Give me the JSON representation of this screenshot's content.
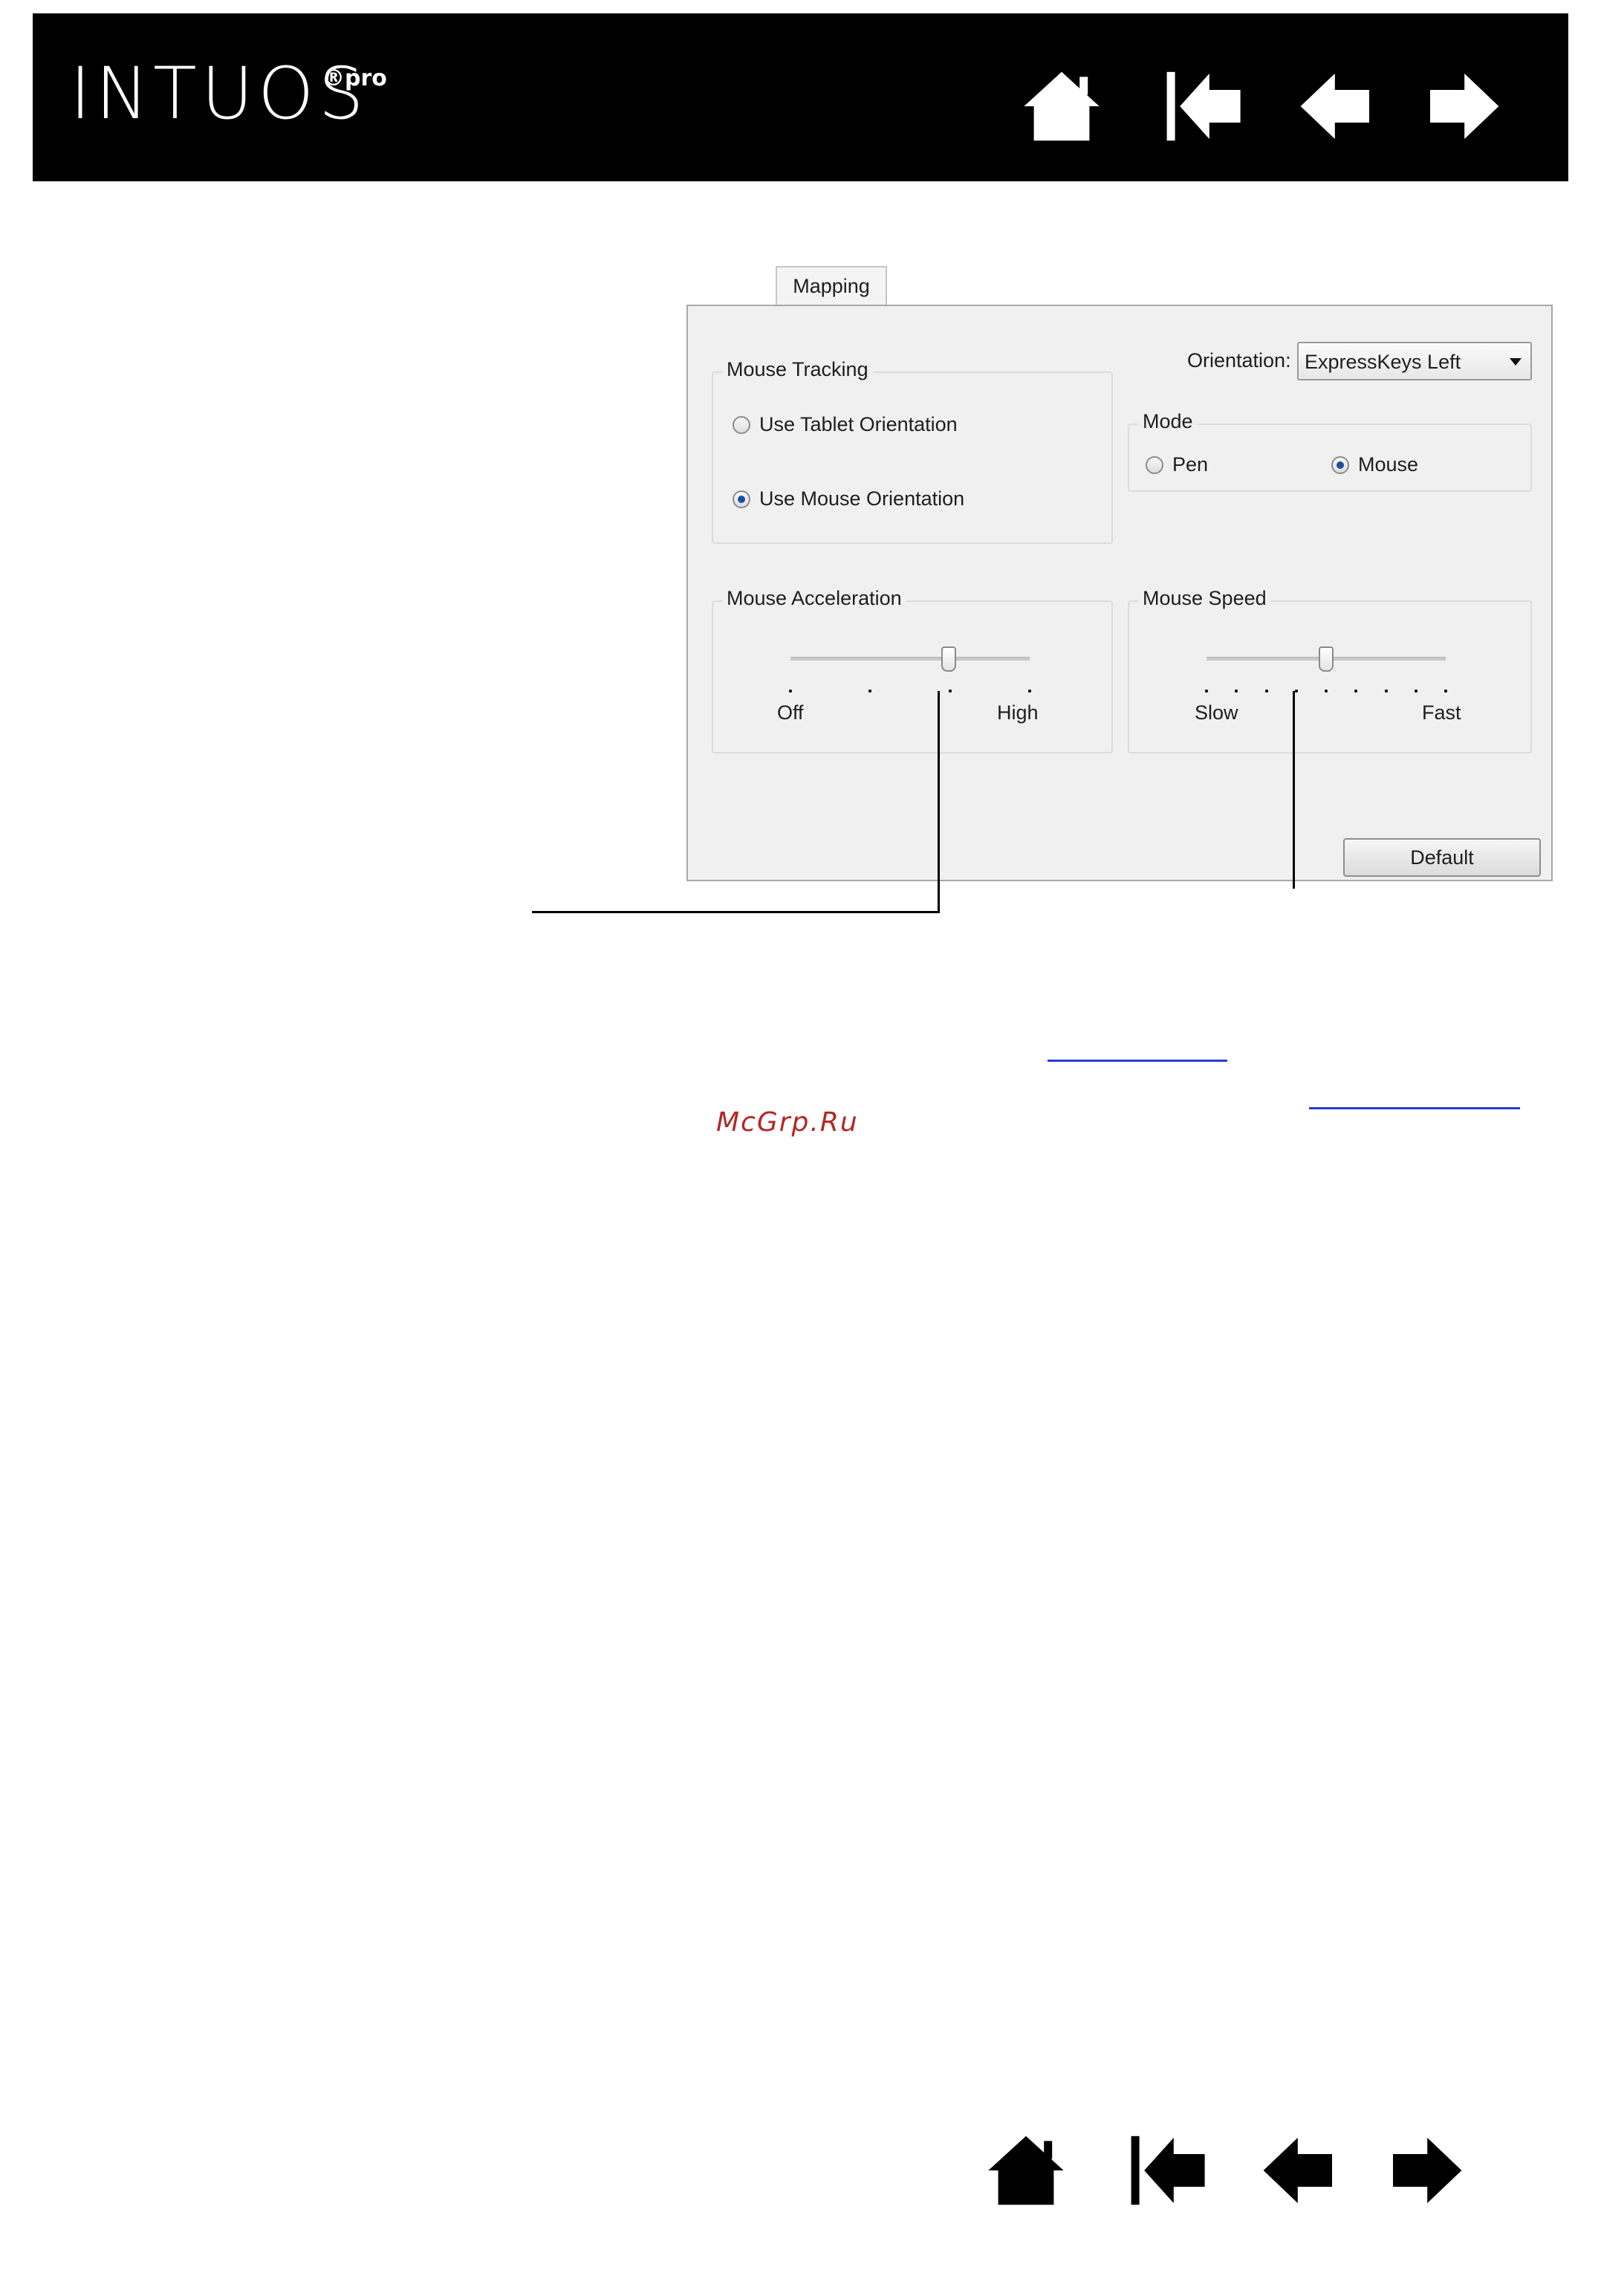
{
  "header": {
    "logo_text": "INTUOS",
    "logo_superscript": "®pro",
    "nav": [
      "home-icon",
      "first-page-icon",
      "previous-page-icon",
      "next-page-icon"
    ]
  },
  "dialog": {
    "tab_label": "Mapping",
    "orientation_label": "Orientation:",
    "orientation_value": "ExpressKeys Left",
    "mouse_tracking": {
      "legend": "Mouse Tracking",
      "option_tablet": "Use Tablet Orientation",
      "option_mouse": "Use Mouse Orientation",
      "selected": "Use Mouse Orientation"
    },
    "mode": {
      "legend": "Mode",
      "option_pen": "Pen",
      "option_mouse": "Mouse",
      "selected": "Mouse"
    },
    "mouse_acceleration": {
      "legend": "Mouse Acceleration",
      "min_label": "Off",
      "max_label": "High",
      "tick_count": 4,
      "value_fraction": 0.66
    },
    "mouse_speed": {
      "legend": "Mouse Speed",
      "min_label": "Slow",
      "max_label": "Fast",
      "tick_count": 9,
      "value_fraction": 0.5
    },
    "default_button": "Default"
  },
  "watermark": "McGrp.Ru",
  "colors": {
    "header_bg": "#000000",
    "radio_selected": "#1b4f9c",
    "link": "#2b3bd8",
    "watermark": "#b32727"
  }
}
